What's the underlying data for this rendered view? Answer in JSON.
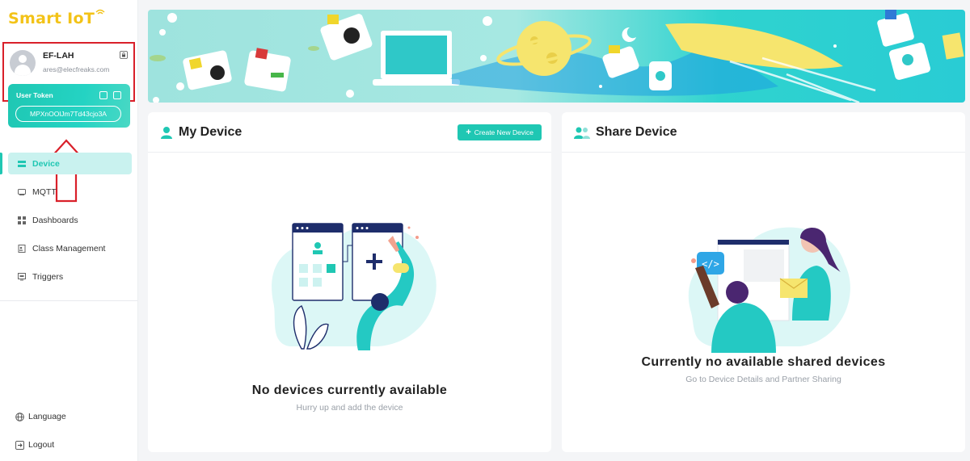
{
  "logo": {
    "text": "Smart IoT"
  },
  "user": {
    "name": "EF-LAH",
    "email": "ares@elecfreaks.com",
    "token_label": "User Token",
    "token_value": "MPXnOOlJm7Td43cjo3A"
  },
  "nav": {
    "items": [
      {
        "label": "Device",
        "icon": "device-icon",
        "active": true
      },
      {
        "label": "MQTT",
        "icon": "mqtt-icon",
        "active": false
      },
      {
        "label": "Dashboards",
        "icon": "dashboards-icon",
        "active": false
      },
      {
        "label": "Class Management",
        "icon": "class-icon",
        "active": false
      },
      {
        "label": "Triggers",
        "icon": "triggers-icon",
        "active": false
      }
    ]
  },
  "footer": {
    "language": "Language",
    "logout": "Logout"
  },
  "my_device": {
    "title": "My Device",
    "create_button": "Create New Device",
    "empty_title": "No devices currently available",
    "empty_sub": "Hurry up and add the device"
  },
  "share_device": {
    "title": "Share Device",
    "empty_title": "Currently no available shared devices",
    "empty_sub": "Go to Device Details and Partner Sharing"
  },
  "colors": {
    "accent": "#1fc7b3",
    "logo": "#f3c318",
    "annotation": "#d9202a"
  }
}
